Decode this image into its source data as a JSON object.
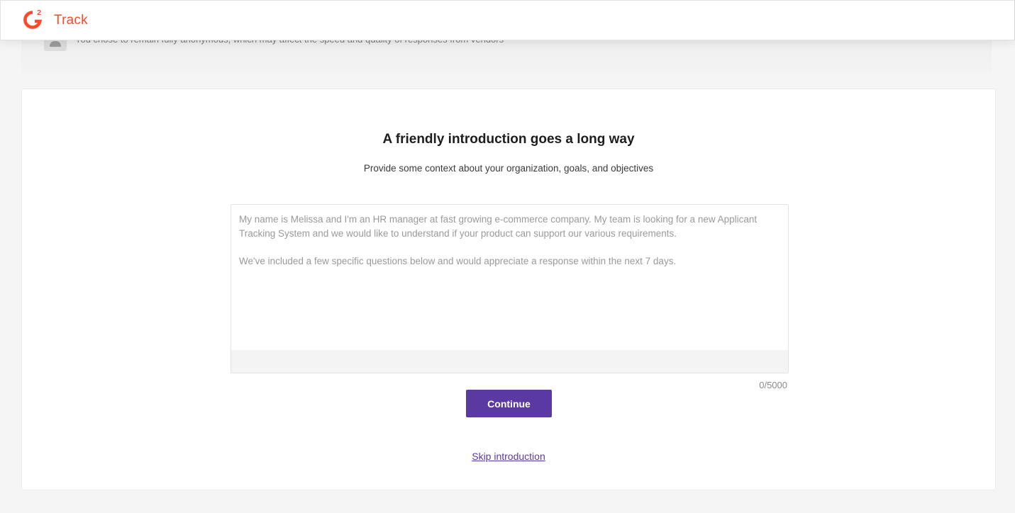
{
  "header": {
    "brand_name": "Track",
    "logo": {
      "icon": "g2-logo-icon",
      "superscript": "2",
      "color": "#ff492c"
    }
  },
  "anonymity_notice": {
    "icon": "user-silhouette-icon",
    "text": "You chose to remain fully anonymous, which may affect the speed and quality of responses from vendors"
  },
  "main": {
    "title": "A friendly introduction goes a long way",
    "subtitle": "Provide some context about your organization, goals, and objectives",
    "intro_field": {
      "value": "",
      "placeholder": "My name is Melissa and I'm an HR manager at fast growing e-commerce company. My team is looking for a new Applicant Tracking System and we would like to understand if your product can support our various requirements.\n\nWe've included a few specific questions below and would appreciate a response within the next 7 days."
    },
    "char_counter": "0/5000",
    "continue_label": "Continue",
    "skip_label": "Skip introduction"
  },
  "colors": {
    "accent": "#5a39a2",
    "brand": "#ff492c",
    "background": "#f5f5f5"
  }
}
